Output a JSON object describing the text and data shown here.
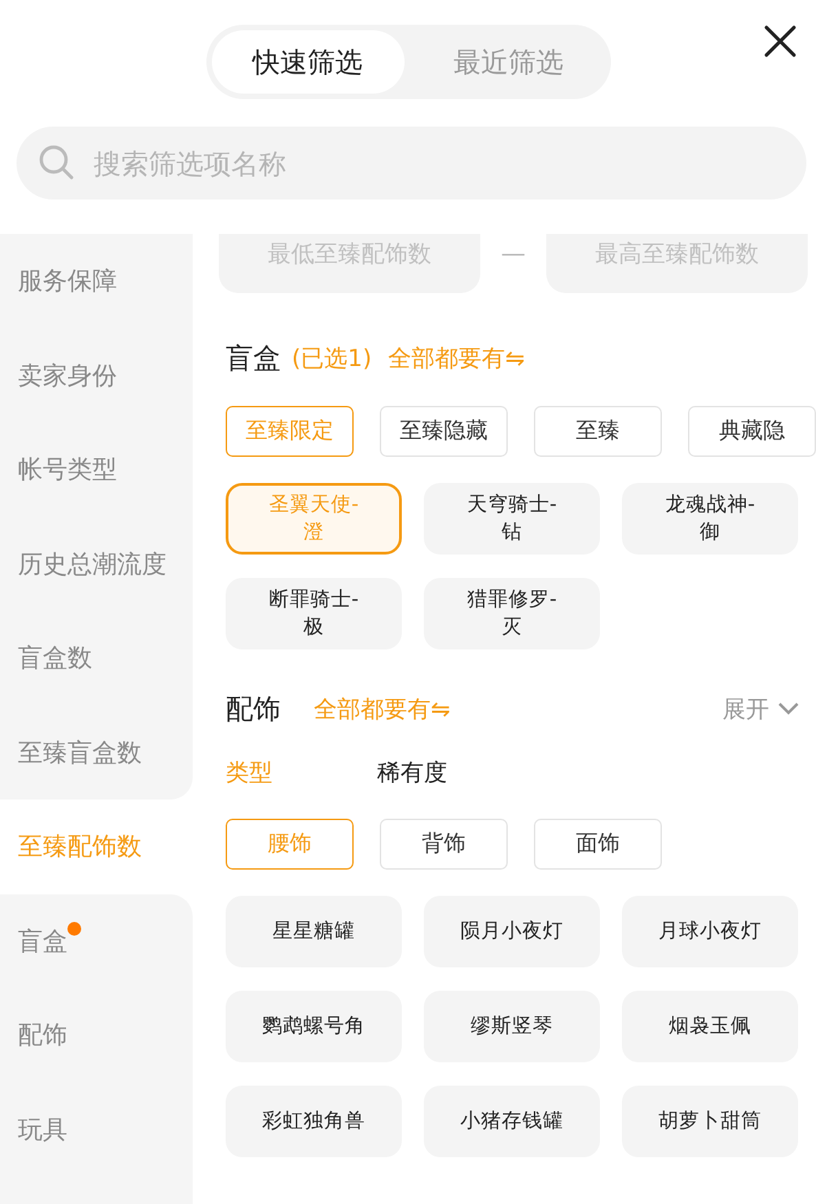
{
  "header": {
    "tabs": [
      {
        "label": "快速筛选",
        "selected": true
      },
      {
        "label": "最近筛选",
        "selected": false
      }
    ]
  },
  "search": {
    "placeholder": "搜索筛选项名称"
  },
  "sidebar": {
    "items": [
      {
        "label": "服务保障",
        "selected": false,
        "dot": false
      },
      {
        "label": "卖家身份",
        "selected": false,
        "dot": false
      },
      {
        "label": "帐号类型",
        "selected": false,
        "dot": false
      },
      {
        "label": "历史总潮流度",
        "selected": false,
        "dot": false
      },
      {
        "label": "盲盒数",
        "selected": false,
        "dot": false
      },
      {
        "label": "至臻盲盒数",
        "selected": false,
        "dot": false
      },
      {
        "label": "至臻配饰数",
        "selected": true,
        "dot": false
      },
      {
        "label": "盲盒",
        "selected": false,
        "dot": true
      },
      {
        "label": "配饰",
        "selected": false,
        "dot": false
      },
      {
        "label": "玩具",
        "selected": false,
        "dot": false
      }
    ]
  },
  "range": {
    "min_placeholder": "最低至臻配饰数",
    "separator": "—",
    "max_placeholder": "最高至臻配饰数"
  },
  "blind_box": {
    "title": "盲盒",
    "selected_note": "(已选1)",
    "match_all": "全部都要有⇋",
    "chips": [
      {
        "label": "至臻限定",
        "selected": true
      },
      {
        "label": "至臻隐藏",
        "selected": false
      },
      {
        "label": "至臻",
        "selected": false
      },
      {
        "label": "典藏隐",
        "selected": false
      }
    ],
    "cards": [
      {
        "label": "圣翼天使-澄",
        "selected": true
      },
      {
        "label": "天穹骑士-钻",
        "selected": false
      },
      {
        "label": "龙魂战神-御",
        "selected": false
      },
      {
        "label": "断罪骑士-极",
        "selected": false
      },
      {
        "label": "猎罪修罗-灭",
        "selected": false
      }
    ]
  },
  "accessories": {
    "title": "配饰",
    "match_all": "全部都要有⇋",
    "expand": "展开",
    "subtabs": [
      {
        "label": "类型",
        "selected": true
      },
      {
        "label": "稀有度",
        "selected": false
      }
    ],
    "chips": [
      {
        "label": "腰饰",
        "selected": true
      },
      {
        "label": "背饰",
        "selected": false
      },
      {
        "label": "面饰",
        "selected": false
      }
    ],
    "cards": [
      {
        "label": "星星糖罐",
        "selected": false
      },
      {
        "label": "陨月小夜灯",
        "selected": false
      },
      {
        "label": "月球小夜灯",
        "selected": false
      },
      {
        "label": "鹦鹉螺号角",
        "selected": false
      },
      {
        "label": "缪斯竖琴",
        "selected": false
      },
      {
        "label": "烟袅玉佩",
        "selected": false
      },
      {
        "label": "彩虹独角兽",
        "selected": false
      },
      {
        "label": "小猪存钱罐",
        "selected": false
      },
      {
        "label": "胡萝卜甜筒",
        "selected": false
      }
    ]
  }
}
